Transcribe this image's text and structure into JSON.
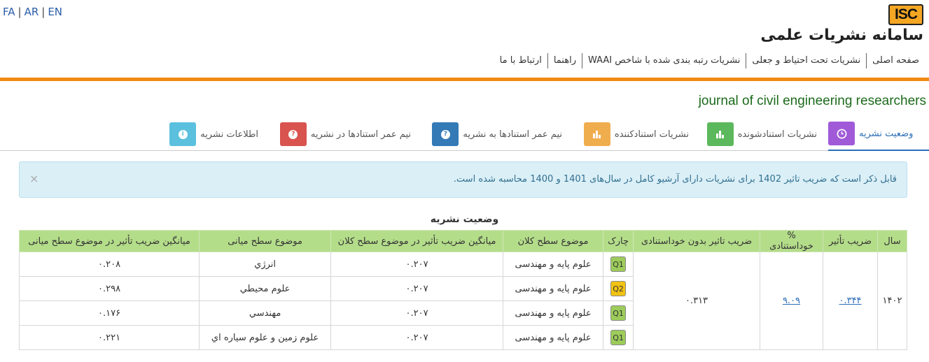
{
  "lang": {
    "fa": "FA",
    "ar": "AR",
    "en": "EN",
    "sep": "|"
  },
  "logo": {
    "text": "ISC"
  },
  "site_title": "سامانه نشریات علمی",
  "nav": [
    "صفحه اصلی",
    "نشریات تحت احتیاط و جعلی",
    "نشریات رتبه بندی شده با شاخص WAAI",
    "راهنما",
    "ارتباط با ما"
  ],
  "journal_title": "journal of civil engineering researchers",
  "tabs": [
    {
      "label": "وضعیت نشریه",
      "icon": "clock-icon",
      "color": "#a05ad8",
      "active": true
    },
    {
      "label": "نشریات استنادشونده",
      "icon": "bar-chart-icon",
      "color": "#5cb85c",
      "active": false
    },
    {
      "label": "نشریات استنادکننده",
      "icon": "bar-chart-icon",
      "color": "#f0ad4e",
      "active": false
    },
    {
      "label": "نیم عمر استنادها به نشریه",
      "icon": "question-icon",
      "color": "#337ab7",
      "active": false
    },
    {
      "label": "نیم عمر استنادها در نشریه",
      "icon": "question-icon",
      "color": "#d9534f",
      "active": false
    },
    {
      "label": "اطلاعات نشریه",
      "icon": "info-icon",
      "color": "#5bc0de",
      "active": false
    }
  ],
  "alert": {
    "message": "قابل ذکر است که ضریب تاثیر 1402 برای نشریات دارای آرشیو کامل در سال‌های 1401 و 1400 محاسبه شده است.",
    "close": "×"
  },
  "table": {
    "title": "وضعیت نشریه",
    "headers": [
      "سال",
      "ضریب تأثیر",
      "% خوداستنادی",
      "ضریب تاثیر بدون خوداستنادی",
      "چارک",
      "موضوع سطح کلان",
      "میانگین ضریب تأثیر در موضوع سطح کلان",
      "موضوع سطح میانی",
      "میانگین ضریب تأثیر در موضوع سطح میانی"
    ],
    "year": "۱۴۰۲",
    "impact_factor": "۰.۳۴۴",
    "self_citation": "۹.۰۹",
    "if_without_self": "۰.۳۱۳",
    "rows": [
      {
        "quartile": "Q1",
        "macro": "علوم پایه و مهندسی",
        "macro_avg": "۰.۲۰۷",
        "mid": "انرژي",
        "mid_avg": "۰.۲۰۸"
      },
      {
        "quartile": "Q2",
        "macro": "علوم پایه و مهندسی",
        "macro_avg": "۰.۲۰۷",
        "mid": "علوم محيطي",
        "mid_avg": "۰.۲۹۸"
      },
      {
        "quartile": "Q1",
        "macro": "علوم پایه و مهندسی",
        "macro_avg": "۰.۲۰۷",
        "mid": "مهندسي",
        "mid_avg": "۰.۱۷۶"
      },
      {
        "quartile": "Q1",
        "macro": "علوم پایه و مهندسی",
        "macro_avg": "۰.۲۰۷",
        "mid": "علوم زمين و علوم سياره اي",
        "mid_avg": "۰.۲۲۱"
      }
    ]
  }
}
